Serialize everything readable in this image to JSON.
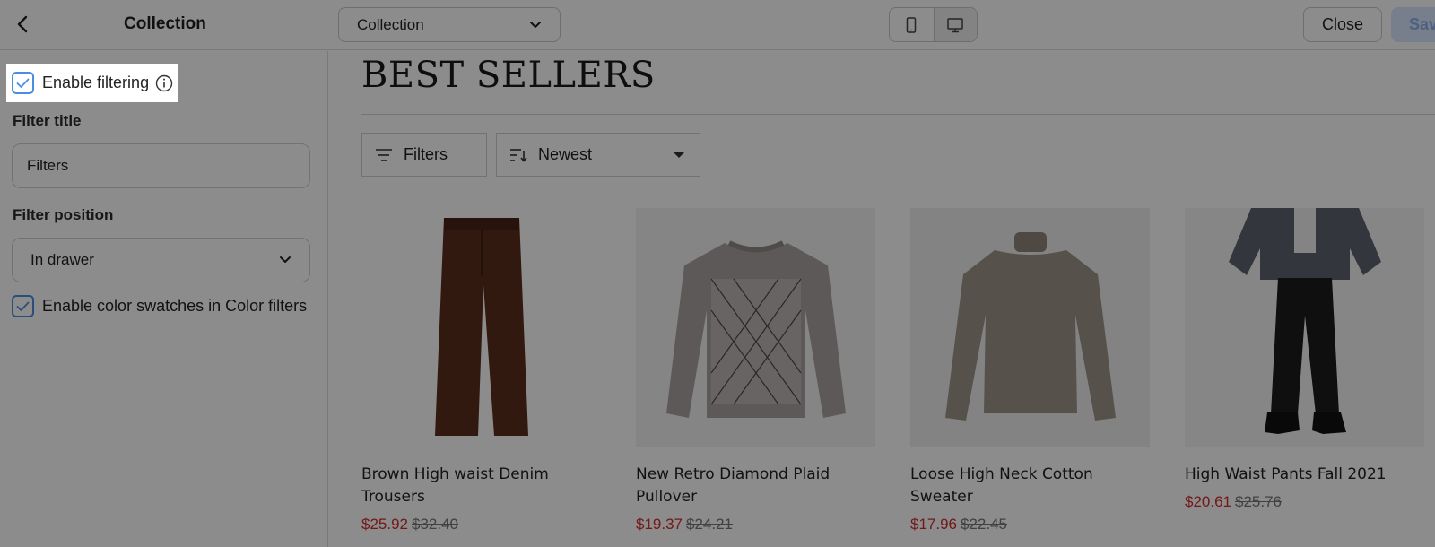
{
  "topbar": {
    "title": "Collection",
    "page_select": "Collection",
    "close_label": "Close",
    "save_label": "Save"
  },
  "sidebar": {
    "enable_filtering_label": "Enable filtering",
    "filter_title_label": "Filter title",
    "filter_title_value": "Filters",
    "filter_position_label": "Filter position",
    "filter_position_value": "In drawer",
    "color_swatches_label": "Enable color swatches in Color filters"
  },
  "preview": {
    "heading": "BEST SELLERS",
    "filters_button": "Filters",
    "sort_value": "Newest",
    "products": [
      {
        "name": "Brown High waist Denim Trousers",
        "sale_price": "$25.92",
        "original_price": "$32.40"
      },
      {
        "name": "New Retro Diamond Plaid Pullover",
        "sale_price": "$19.37",
        "original_price": "$24.21"
      },
      {
        "name": "Loose High Neck Cotton Sweater",
        "sale_price": "$17.96",
        "original_price": "$22.45"
      },
      {
        "name": "High Waist Pants Fall 2021",
        "sale_price": "$20.61",
        "original_price": "$25.76"
      }
    ]
  },
  "colors": {
    "accent": "#4a8ee0",
    "sale_price": "#d32c2c",
    "overlay": "rgba(0,0,0,0.45)"
  }
}
